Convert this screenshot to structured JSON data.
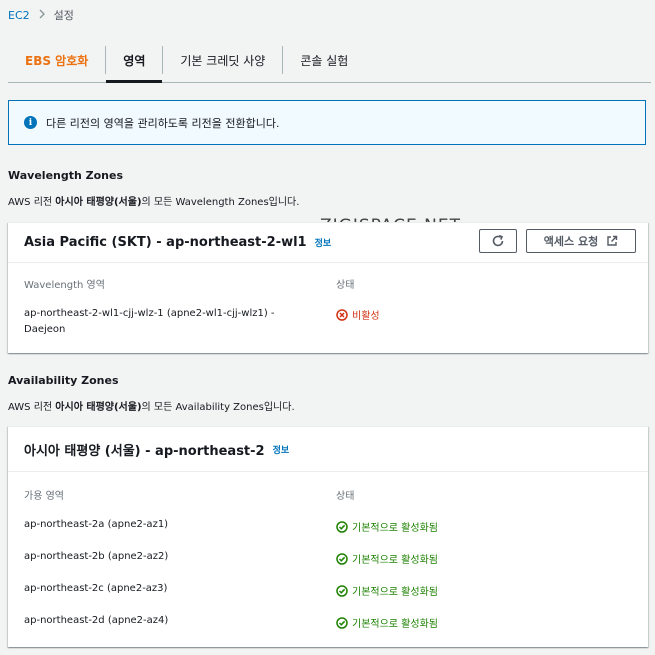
{
  "breadcrumb": {
    "root": "EC2",
    "separator": ">",
    "current": "설정"
  },
  "tabs": [
    {
      "label": "EBS 암호화"
    },
    {
      "label": "영역"
    },
    {
      "label": "기본 크레딧 사양"
    },
    {
      "label": "콘솔 실험"
    }
  ],
  "alert": {
    "text": "다른 리전의 영역을 관리하도록 리전을 전환합니다."
  },
  "wavelength": {
    "section_title": "Wavelength Zones",
    "desc_prefix": "AWS 리전 ",
    "desc_region": "아시아 태평양(서울)",
    "desc_suffix": "의 모든 Wavelength Zones입니다.",
    "card_title": "Asia Pacific (SKT) - ap-northeast-2-wl1",
    "info_link": "정보",
    "request_button": "액세스 요청",
    "col_zone": "Wavelength 영역",
    "col_status": "상태",
    "rows": [
      {
        "zone_line1": "ap-northeast-2-wl1-cjj-wlz-1 (apne2-wl1-cjj-wlz1) -",
        "zone_line2": "Daejeon",
        "status": "비활성"
      }
    ]
  },
  "watermark": "ZIGISPACE.NET",
  "availability": {
    "section_title": "Availability Zones",
    "desc_prefix": "AWS 리전 ",
    "desc_region": "아시아 태평양(서울)",
    "desc_suffix": "의 모든 Availability Zones입니다.",
    "card_title": "아시아 태평양 (서울) - ap-northeast-2",
    "info_link": "정보",
    "col_zone": "가용 영역",
    "col_status": "상태",
    "rows": [
      {
        "zone": "ap-northeast-2a (apne2-az1)",
        "status": "기본적으로 활성화됨"
      },
      {
        "zone": "ap-northeast-2b (apne2-az2)",
        "status": "기본적으로 활성화됨"
      },
      {
        "zone": "ap-northeast-2c (apne2-az3)",
        "status": "기본적으로 활성화됨"
      },
      {
        "zone": "ap-northeast-2d (apne2-az4)",
        "status": "기본적으로 활성화됨"
      }
    ]
  },
  "colors": {
    "link": "#0073bb",
    "active_tab": "#ec7211",
    "error": "#d13212",
    "success": "#1d8102"
  }
}
